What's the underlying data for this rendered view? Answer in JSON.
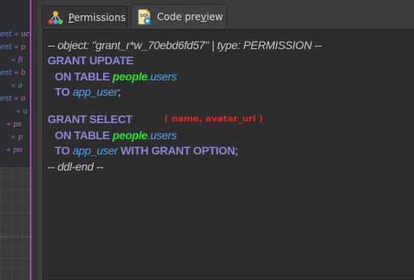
{
  "background_list": {
    "rows": [
      {
        "prefix": "ent",
        "text": "« uc"
      },
      {
        "prefix": "ent",
        "text": "« p"
      },
      {
        "prefix": "",
        "text": "« fi"
      },
      {
        "prefix": "ent",
        "text": "« b"
      },
      {
        "prefix": "",
        "text": "« o"
      },
      {
        "prefix": "ent",
        "text": "« o"
      },
      {
        "prefix": "",
        "text": "« u"
      },
      {
        "prefix": "",
        "text": "« ps"
      },
      {
        "prefix": "",
        "text": "« p"
      },
      {
        "prefix": "",
        "text": "« po"
      }
    ]
  },
  "tabs": [
    {
      "label_before": "",
      "label_mnemonic": "P",
      "label_after": "ermissions",
      "icon": "permissions-hierarchy-icon"
    },
    {
      "label_before": "Code pre",
      "label_mnemonic": "v",
      "label_after": "iew",
      "icon": "sql-document-icon"
    }
  ],
  "code": {
    "line1": "-- object: \"grant_r*w_70ebd6fd57\" | type: PERMISSION --",
    "line2": "GRANT UPDATE",
    "line3_kw": "ON TABLE ",
    "line3_schema": "people",
    "line3_dot": ".",
    "line3_table": "users",
    "line4_kw": "TO ",
    "line4_role": "app_user",
    "line4_end": ";",
    "line6": "GRANT SELECT",
    "line6_annotation": "( name, avatar_url )",
    "line7_kw": "ON TABLE ",
    "line7_schema": "people",
    "line7_dot": ".",
    "line7_table": "users",
    "line8_kw": "TO ",
    "line8_role": "app_user",
    "line8_option": " WITH GRANT OPTION",
    "line8_end": ";",
    "line9": "-- ddl-end --"
  },
  "colors": {
    "keyword": "#8b86d6",
    "schema": "#27e32b",
    "identifier": "#4ea3f0",
    "annotation": "#e8221c",
    "comment": "#c9c9c9"
  }
}
